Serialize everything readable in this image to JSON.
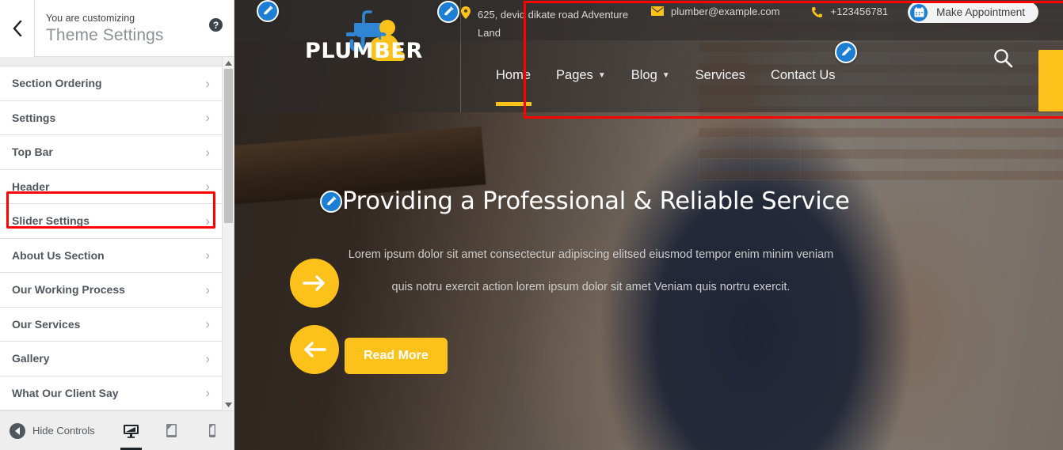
{
  "sidebar": {
    "back_icon": "chevron-left-icon",
    "customizing_label": "You are customizing",
    "theme_name": "Theme Settings",
    "help_label": "?",
    "items": [
      {
        "label": "Section Ordering",
        "chevron": "›"
      },
      {
        "label": "Settings",
        "chevron": "›"
      },
      {
        "label": "Top Bar",
        "chevron": "›"
      },
      {
        "label": "Header",
        "chevron": "›"
      },
      {
        "label": "Slider Settings",
        "chevron": "›"
      },
      {
        "label": "About Us Section",
        "chevron": "›"
      },
      {
        "label": "Our Working Process",
        "chevron": "›"
      },
      {
        "label": "Our Services",
        "chevron": "›"
      },
      {
        "label": "Gallery",
        "chevron": "›"
      },
      {
        "label": "What Our Client Say",
        "chevron": "›"
      }
    ],
    "highlighted_item": "Top Bar",
    "footer": {
      "hide_controls_label": "Hide Controls",
      "devices": [
        {
          "name": "desktop",
          "active": true
        },
        {
          "name": "tablet",
          "active": false
        },
        {
          "name": "mobile",
          "active": false
        }
      ]
    }
  },
  "preview": {
    "topbar": {
      "address": "625, devid dikate road Adventure Land",
      "email": "plumber@example.com",
      "phone": "+123456781",
      "appointment_label": "Make Appointment"
    },
    "logo": {
      "word": "PLUMBER"
    },
    "nav": [
      {
        "label": "Home",
        "has_caret": false,
        "active": true
      },
      {
        "label": "Pages",
        "has_caret": true,
        "active": false
      },
      {
        "label": "Blog",
        "has_caret": true,
        "active": false
      },
      {
        "label": "Services",
        "has_caret": false,
        "active": false
      },
      {
        "label": "Contact Us",
        "has_caret": false,
        "active": false
      }
    ],
    "hero": {
      "title": "Providing a Professional & Reliable Service",
      "paragraph": "Lorem ipsum dolor sit amet consectectur adipiscing elitsed eiusmod tempor enim minim veniam quis notru exercit action lorem ipsum dolor sit amet Veniam quis nortru exercit.",
      "read_more_label": "Read More"
    }
  },
  "colors": {
    "accent_yellow": "#fcc21b",
    "edit_blue": "#1d7fd4",
    "annotation_red": "#fe0000",
    "logo_blue": "#2f86d4",
    "sidebar_text": "#50575e"
  }
}
